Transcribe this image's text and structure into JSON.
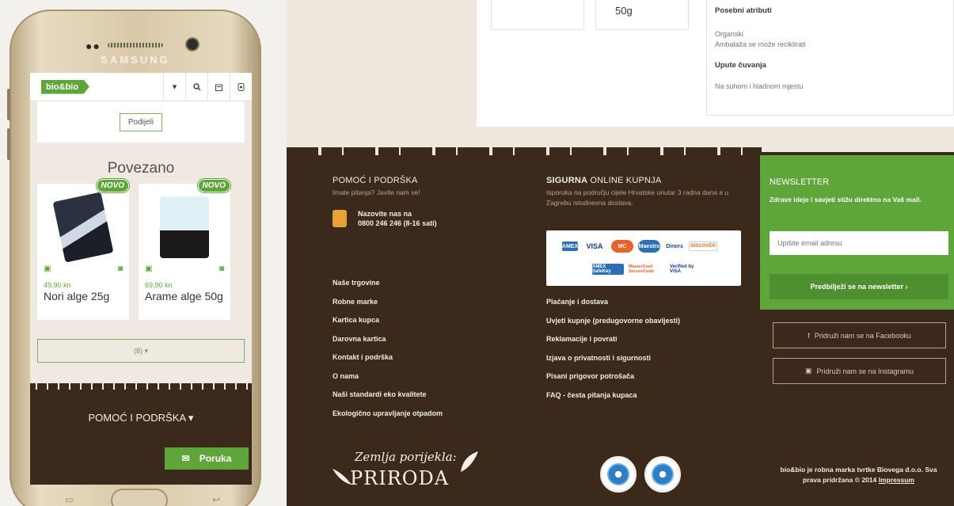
{
  "phone": {
    "brand": "SAMSUNG",
    "logo": "bio&bio",
    "header_icons": [
      "chevron-down-icon",
      "search-icon",
      "bag-icon",
      "account-icon"
    ],
    "share_label": "Podijeli",
    "related_title": "Povezano",
    "badge_label": "NOVO",
    "products": [
      {
        "price": "49,90 kn",
        "name": "Nori alge 25g"
      },
      {
        "price": "69,90 kn",
        "name": "Arame alge 50g"
      }
    ],
    "dropdown_label": "(8) ▾",
    "footer_help": "POMOĆ I PODRŠKA ▾",
    "message_label": "Poruka"
  },
  "spec": {
    "weight": "50g",
    "special_title": "Posebni atributi",
    "special_items": [
      "Organski",
      "Ambalaža se može reciklirati"
    ],
    "storage_title": "Upute čuvanja",
    "storage_text": "Na suhom i hladnom mjestu"
  },
  "footer": {
    "help": {
      "title": "POMOĆ I PODRŠKA",
      "subtitle": "Imate pitanja? Javite nam se!",
      "call_line1": "Nazovite nas na",
      "call_line2": "0800 246 246 (8-16 sati)",
      "links": [
        "Naše trgovine",
        "Robne marke",
        "Kartica kupca",
        "Darovna kartica",
        "Kontakt i podrška",
        "O nama",
        "Naši standardi eko kvalitete",
        "Ekologično upravljanje otpadom"
      ]
    },
    "secure": {
      "title_bold": "SIGURNA",
      "title_rest": " ONLINE KUPNJA",
      "subtitle": "Isporuka na području cijele Hrvatske unutar 3 radna dana a u Zagrebu istodnevna dostava.",
      "cards_row1": [
        "AMEX",
        "VISA",
        "MC",
        "Maestro",
        "Diners",
        "DISCOVER"
      ],
      "cards_row2": [
        "AMEX SafeKey",
        "MasterCard SecureCode",
        "Verified by VISA"
      ],
      "links": [
        "Plaćanje i dostava",
        "Uvjeti kupnje (predugovorne obavijesti)",
        "Reklamacije i povrati",
        "Izjava o privatnosti i sigurnosti",
        "Pisani prigovor potrošača",
        "FAQ - česta pitanja kupaca"
      ]
    },
    "newsletter": {
      "title": "NEWSLETTER",
      "text": "Zdrave ideje i savjeti stižu direktno na Vaš mail.",
      "placeholder": "Upišite email adresu",
      "button": "Predbilježi se na newsletter ›"
    },
    "social": {
      "facebook": "Pridruži nam se na Facebooku",
      "instagram": "Pridruži nam se na Instagramu"
    },
    "logo_line1": "Zemlja porijekla:",
    "logo_line2": "PRIRODA",
    "copyright_line1": "bio&bio je robna marka tvrtke Biovega d.o.o. Sva",
    "copyright_line2": "prava pridržana © 2014",
    "impressum": "Impressum"
  },
  "colors": {
    "brand_green": "#5fa63a",
    "footer_brown": "#3b2a1c",
    "bg_beige": "#efe8df"
  }
}
